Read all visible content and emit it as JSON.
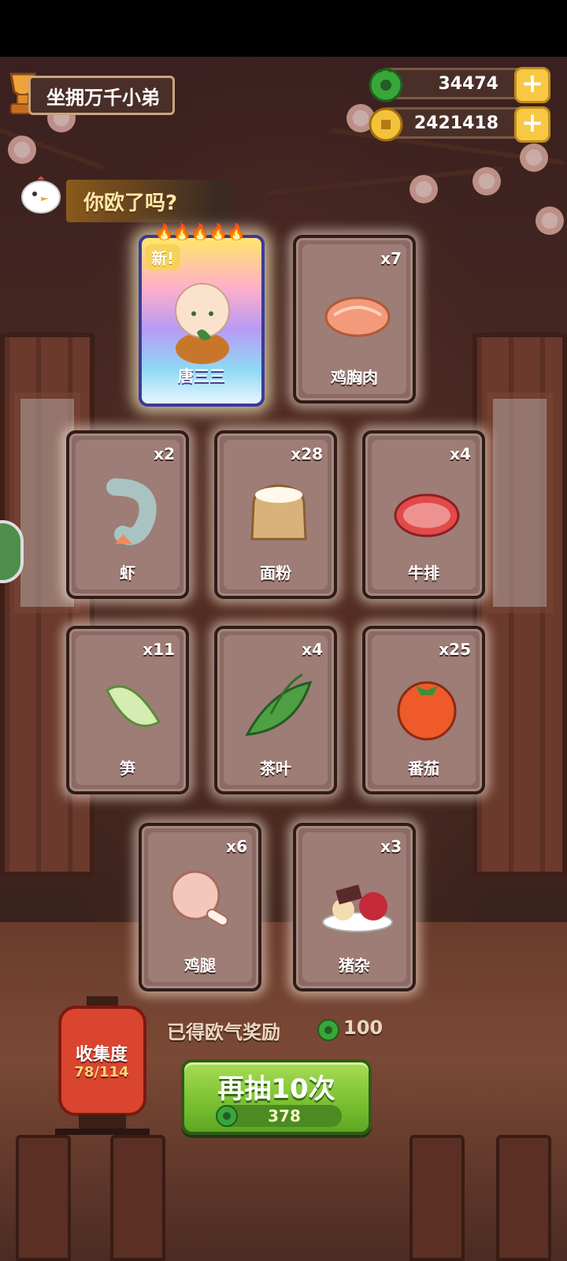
{
  "header": {
    "title": "坐拥万千小弟",
    "jade_amount": "34474",
    "coin_amount": "2421418",
    "jade_plus": "+",
    "coin_plus": "+"
  },
  "banner": {
    "text": "你欧了吗?"
  },
  "special_card": {
    "name": "唐三三",
    "tag": "新!",
    "flames": "🔥🔥🔥🔥🔥"
  },
  "cards": [
    {
      "name": "鸡胸肉",
      "count": "x7"
    },
    {
      "name": "虾",
      "count": "x2"
    },
    {
      "name": "面粉",
      "count": "x28"
    },
    {
      "name": "牛排",
      "count": "x4"
    },
    {
      "name": "笋",
      "count": "x11"
    },
    {
      "name": "茶叶",
      "count": "x4"
    },
    {
      "name": "番茄",
      "count": "x25"
    },
    {
      "name": "鸡腿",
      "count": "x6"
    },
    {
      "name": "猪杂",
      "count": "x3"
    }
  ],
  "collection": {
    "label": "收集度",
    "progress": "78/114"
  },
  "reward": {
    "label": "已得欧气奖励",
    "value": "100"
  },
  "draw_button": {
    "label": "再抽10次",
    "cost": "378"
  },
  "colors": {
    "jade": "#3aa63a",
    "coin": "#e9b72c",
    "button_green": "#7cc232"
  }
}
